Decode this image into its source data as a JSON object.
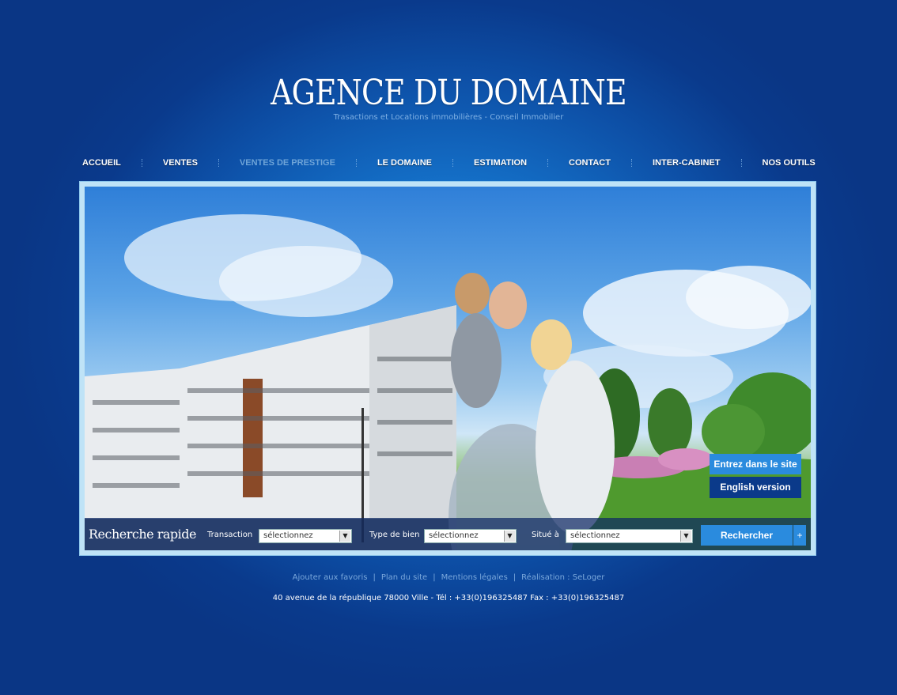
{
  "header": {
    "logo": "AGENCE DU DOMAINE",
    "tagline": "Trasactions et Locations immobilières - Conseil Immobilier"
  },
  "nav": {
    "items": [
      {
        "label": "ACCUEIL"
      },
      {
        "label": "VENTES"
      },
      {
        "label": "VENTES DE PRESTIGE"
      },
      {
        "label": "LE DOMAINE"
      },
      {
        "label": "ESTIMATION"
      },
      {
        "label": "CONTACT"
      },
      {
        "label": "INTER-CABINET"
      },
      {
        "label": "NOS OUTILS"
      }
    ]
  },
  "hero": {
    "enter_label": "Entrez dans le site",
    "english_label": "English version"
  },
  "search": {
    "title": "Recherche rapide",
    "transaction_label": "Transaction",
    "transaction_value": "sélectionnez",
    "type_label": "Type de bien",
    "type_value": "sélectionnez",
    "location_label": "Situé à",
    "location_value": "sélectionnez",
    "search_label": "Rechercher",
    "plus_label": "+"
  },
  "footer": {
    "links": [
      "Ajouter aux favoris",
      "Plan du site",
      "Mentions légales",
      "Réalisation : SeLoger"
    ],
    "separator": "|",
    "address": "40 avenue de la république  78000 Ville   -   Tél : +33(0)196325487 Fax : +33(0)196325487"
  },
  "colors": {
    "accent": "#2a8bde",
    "dark_button": "#0b3a8a",
    "background": "#0a3a8c"
  }
}
